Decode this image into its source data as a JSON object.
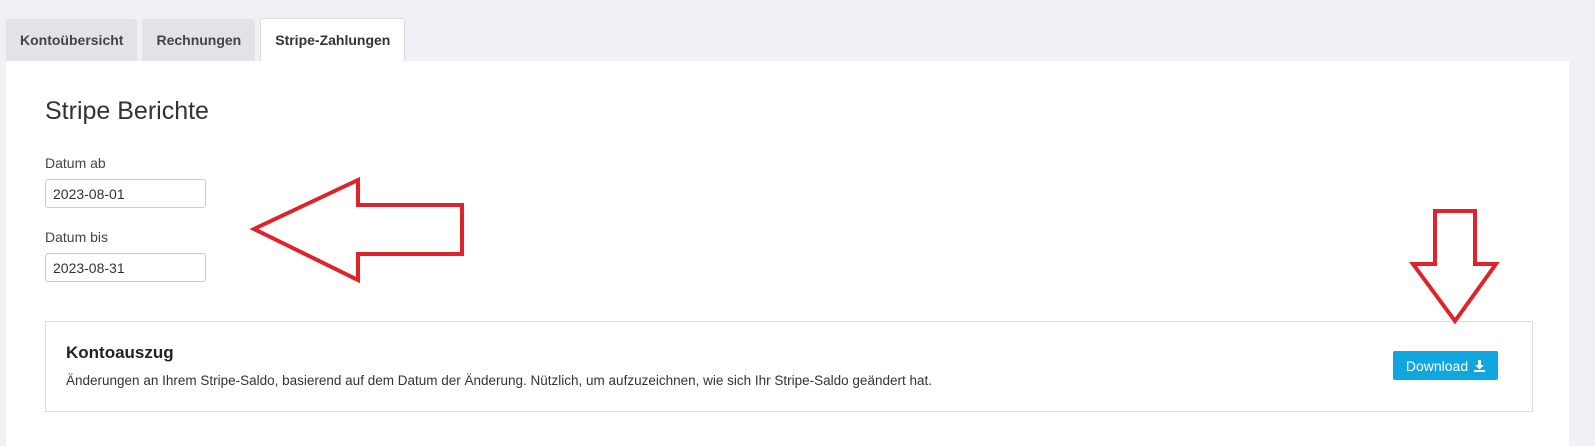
{
  "tabs": [
    {
      "label": "Kontoübersicht",
      "active": false
    },
    {
      "label": "Rechnungen",
      "active": false
    },
    {
      "label": "Stripe-Zahlungen",
      "active": true
    }
  ],
  "main": {
    "title": "Stripe Berichte",
    "date_from": {
      "label": "Datum ab",
      "value": "2023-08-01"
    },
    "date_to": {
      "label": "Datum bis",
      "value": "2023-08-31"
    }
  },
  "report_card": {
    "title": "Kontoauszug",
    "description": "Änderungen an Ihrem Stripe-Saldo, basierend auf dem Datum der Änderung. Nützlich, um aufzuzeichnen, wie sich Ihr Stripe-Saldo geändert hat.",
    "download_label": "Download",
    "download_icon": "download-icon"
  },
  "colors": {
    "accent": "#10a7e0",
    "annotation": "#e0232a"
  }
}
